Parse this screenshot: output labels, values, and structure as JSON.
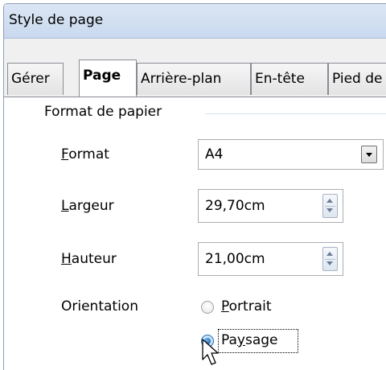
{
  "window": {
    "title": "Style de page"
  },
  "tabs": [
    {
      "label": "Gérer",
      "active": false
    },
    {
      "label": "Page",
      "active": true
    },
    {
      "label": "Arrière-plan",
      "active": false
    },
    {
      "label": "En-tête",
      "active": false
    },
    {
      "label": "Pied de",
      "active": false
    }
  ],
  "paper": {
    "group_title": "Format de papier",
    "format": {
      "label_key": "F",
      "label_rest": "ormat",
      "value": "A4"
    },
    "width": {
      "label_key": "L",
      "label_rest": "argeur",
      "value": "29,70cm"
    },
    "height": {
      "label_key": "H",
      "label_rest": "auteur",
      "value": "21,00cm"
    },
    "orientation": {
      "label": "Orientation",
      "portrait": {
        "label_key": "P",
        "label_rest": "ortrait",
        "checked": false
      },
      "landscape": {
        "label_pre": "Pa",
        "label_key": "y",
        "label_rest": "sage",
        "checked": true
      }
    }
  },
  "icons": {
    "cursor": "mouse-pointer-icon"
  },
  "colors": {
    "accent": "#2b6eb3",
    "titlebar": "#cfdcee"
  }
}
